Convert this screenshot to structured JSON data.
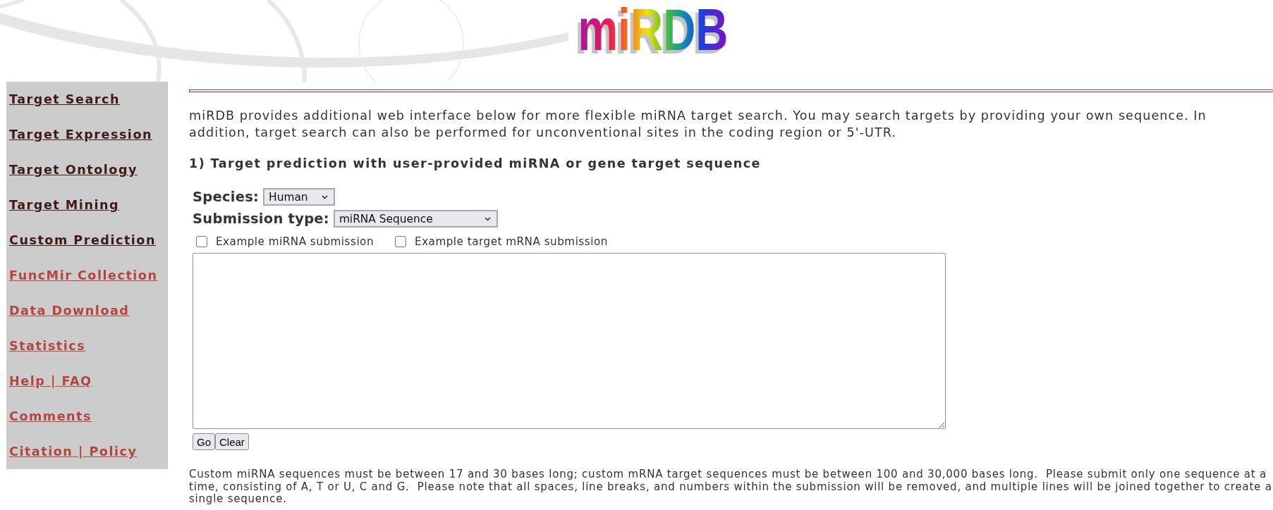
{
  "logo": {
    "text": "miRDB"
  },
  "sidebar": {
    "items": [
      {
        "label": "Target Search",
        "visited": true
      },
      {
        "label": "Target Expression",
        "visited": true
      },
      {
        "label": "Target Ontology",
        "visited": true
      },
      {
        "label": "Target Mining",
        "visited": true
      },
      {
        "label": "Custom Prediction",
        "visited": true
      },
      {
        "label": "FuncMir Collection",
        "visited": false
      },
      {
        "label": "Data Download",
        "visited": false
      },
      {
        "label": "Statistics",
        "visited": false
      },
      {
        "label": "Help | FAQ",
        "visited": false
      },
      {
        "label": "Comments",
        "visited": false
      },
      {
        "label": "Citation | Policy",
        "visited": false
      }
    ]
  },
  "intro": "miRDB provides additional web interface below for more flexible miRNA target search. You may search targets by providing your own sequence. In addition, target search can also be performed for unconventional sites in the coding region or 5'-UTR.",
  "section": {
    "heading": "1) Target prediction with user-provided miRNA or gene target sequence",
    "fields": [
      {
        "label": "Species:",
        "value": "Human"
      },
      {
        "label": "Submission type:",
        "value": "miRNA Sequence"
      }
    ],
    "checkboxes": [
      {
        "label": "Example miRNA submission",
        "checked": false
      },
      {
        "label": "Example target mRNA submission",
        "checked": false
      }
    ],
    "buttons": [
      "Go",
      "Clear"
    ]
  },
  "note": "Custom miRNA sequences must be between 17 and 30 bases long; custom mRNA target sequences must be between 100 and 30,000 bases long.  Please submit only one sequence at a time, consisting of A, T or U, C and G.  Please note that all spaces, line breaks, and numbers within the submission will be removed, and multiple lines will be joined together to create a single sequence."
}
